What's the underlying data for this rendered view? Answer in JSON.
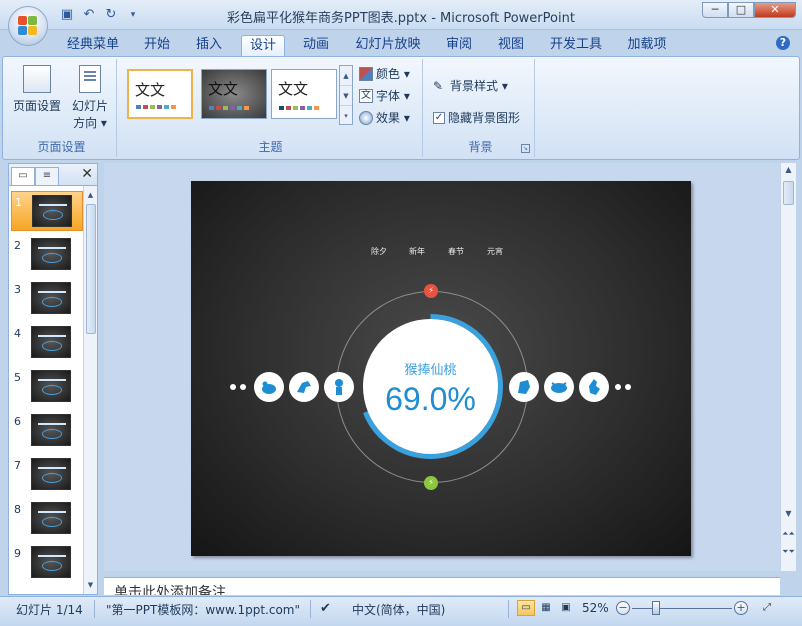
{
  "window": {
    "title": "彩色扁平化猴年商务PPT图表.pptx - Microsoft PowerPoint",
    "controls": [
      "─",
      "□",
      "✕"
    ]
  },
  "quick_access": {
    "save_icon": "save-icon",
    "undo_icon": "undo-icon",
    "redo_icon": "redo-icon"
  },
  "tabs": [
    "经典菜单",
    "开始",
    "插入",
    "设计",
    "动画",
    "幻灯片放映",
    "审阅",
    "视图",
    "开发工具",
    "加载项"
  ],
  "active_tab": "设计",
  "ribbon": {
    "page_setup_group": {
      "label": "页面设置",
      "page_setup": "页面设置",
      "orientation_line1": "幻灯片",
      "orientation_line2": "方向 ▾"
    },
    "theme_group": {
      "label": "主题",
      "themes": [
        "文文",
        "文文",
        "文文"
      ],
      "colors": "颜色 ▾",
      "fonts": "字体 ▾",
      "effects": "效果 ▾"
    },
    "background_group": {
      "label": "背景",
      "background_styles": "背景样式 ▾",
      "hide_background_graphics": "隐藏背景图形",
      "hide_checked": true
    }
  },
  "slide_panel": {
    "thumbnails": [
      "1",
      "2",
      "3",
      "4",
      "5",
      "6",
      "7",
      "8",
      "9"
    ],
    "selected": 1
  },
  "slide": {
    "menu": [
      "除夕",
      "新年",
      "春节",
      "元宵"
    ],
    "center_title": "猴捧仙桃",
    "center_value": "69.0%",
    "progress_fraction": 0.69,
    "accent_blue": "#3aa1df",
    "accent_red": "#e85340",
    "accent_green": "#8cc63f"
  },
  "notes_placeholder": "单击此处添加备注",
  "statusbar": {
    "slide_info": "幻灯片 1/14",
    "theme_name": "\"第一PPT模板网：www.1ppt.com\"",
    "language": "中文(简体，中国)",
    "zoom": "52%"
  }
}
